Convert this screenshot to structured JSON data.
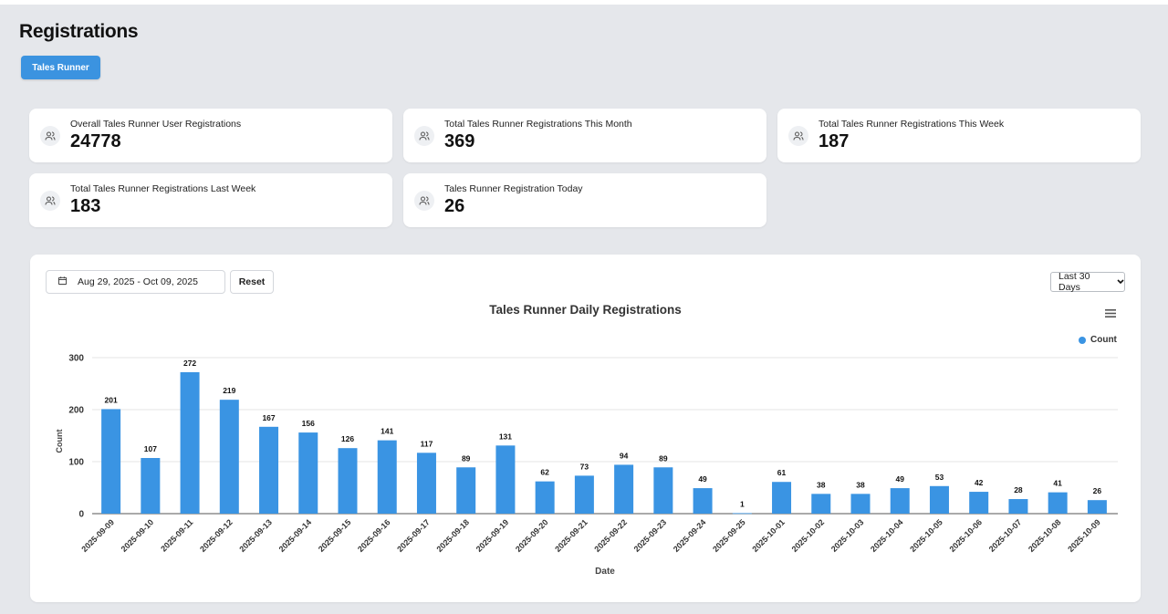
{
  "page": {
    "title": "Registrations",
    "tab_label": "Tales Runner"
  },
  "stats": [
    {
      "label": "Overall Tales Runner User Registrations",
      "value": "24778",
      "icon": "users-icon"
    },
    {
      "label": "Total Tales Runner Registrations This Month",
      "value": "369",
      "icon": "users-icon"
    },
    {
      "label": "Total Tales Runner Registrations This Week",
      "value": "187",
      "icon": "users-icon"
    },
    {
      "label": "Total Tales Runner Registrations Last Week",
      "value": "183",
      "icon": "users-icon"
    },
    {
      "label": "Tales Runner Registration Today",
      "value": "26",
      "icon": "users-icon"
    }
  ],
  "filters": {
    "date_range": "Aug 29, 2025 - Oct 09, 2025",
    "reset_label": "Reset",
    "range_select": "Last 30 Days"
  },
  "colors": {
    "accent": "#3b93e0",
    "bar": "#3a94e3",
    "background": "#e5e7eb"
  },
  "chart_data": {
    "type": "bar",
    "title": "Tales Runner Daily Registrations",
    "xlabel": "Date",
    "ylabel": "Count",
    "ylim": [
      0,
      300
    ],
    "yticks": [
      0,
      100,
      200,
      300
    ],
    "grid": true,
    "legend_position": "top-right",
    "categories": [
      "2025-09-09",
      "2025-09-10",
      "2025-09-11",
      "2025-09-12",
      "2025-09-13",
      "2025-09-14",
      "2025-09-15",
      "2025-09-16",
      "2025-09-17",
      "2025-09-18",
      "2025-09-19",
      "2025-09-20",
      "2025-09-21",
      "2025-09-22",
      "2025-09-23",
      "2025-09-24",
      "2025-09-25",
      "2025-10-01",
      "2025-10-02",
      "2025-10-03",
      "2025-10-04",
      "2025-10-05",
      "2025-10-06",
      "2025-10-07",
      "2025-10-08",
      "2025-10-09"
    ],
    "series": [
      {
        "name": "Count",
        "values": [
          201,
          107,
          272,
          219,
          167,
          156,
          126,
          141,
          117,
          89,
          131,
          62,
          73,
          94,
          89,
          49,
          1,
          61,
          38,
          38,
          49,
          53,
          42,
          28,
          41,
          26
        ]
      }
    ]
  }
}
